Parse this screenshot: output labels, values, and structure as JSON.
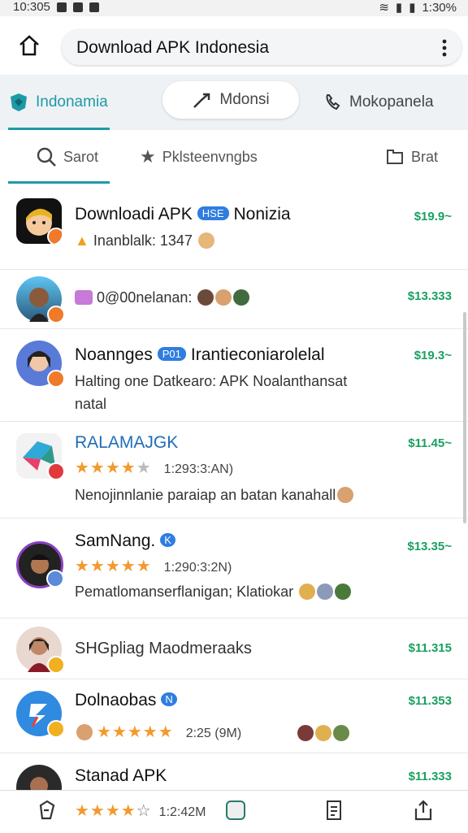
{
  "status": {
    "time_left": "10:305",
    "time_right": "1:30%"
  },
  "urlbar": {
    "title": "Download APK Indonesia"
  },
  "tabs_top": [
    {
      "label": "Indonamia"
    },
    {
      "label": "Mdonsi"
    },
    {
      "label": "Mokopanela"
    }
  ],
  "tabs_second": [
    {
      "label": "Sarot"
    },
    {
      "label": "Pklsteenvngbs"
    },
    {
      "label": "Brat"
    }
  ],
  "items": [
    {
      "title": "Downloadi APK",
      "tag": "HSE",
      "title_suffix": "Nonizia",
      "sub": "Inanblalk: 1347",
      "price": "$19.9~"
    },
    {
      "title": "",
      "tag": "",
      "title_suffix": "",
      "sub": "0@00nelanan:",
      "price": "$13.333"
    },
    {
      "title": "Noannges",
      "tag": "P01",
      "title_suffix": "Irantieconiarolelal",
      "sub": "Halting one Datkearo: APK Noalanthansat",
      "sub2": "natal",
      "price": "$19.3~"
    },
    {
      "title": "RALAMAJGK",
      "tag": "",
      "title_suffix": "",
      "stars_text": "1:293:3:AN)",
      "sub": "Nenojinnlanie paraiap an batan kanahall",
      "price": "$11.45~"
    },
    {
      "title": "SamNang.",
      "tag": "K",
      "title_suffix": "",
      "stars_text": "1:290:3:2N)",
      "sub": "Pematlomanserflanigan; Klatiokar",
      "price": "$13.35~"
    },
    {
      "title": "SHGpliag Maodmeraaks",
      "tag": "",
      "title_suffix": "",
      "sub": "",
      "price": "$11.315"
    },
    {
      "title": "Dolnaobas",
      "tag": "N",
      "title_suffix": "",
      "stars_text": "2:25 (9M)",
      "sub": "",
      "price": "$11.353"
    },
    {
      "title": "Stanad APK",
      "tag": "",
      "title_suffix": "",
      "stars_text": "1:2:42M",
      "sub": "",
      "price": "$11.333"
    }
  ],
  "colors": {
    "accent": "#1e9aa6",
    "price": "#1aa061",
    "star": "#f29a2e",
    "tag": "#2f7de0"
  }
}
